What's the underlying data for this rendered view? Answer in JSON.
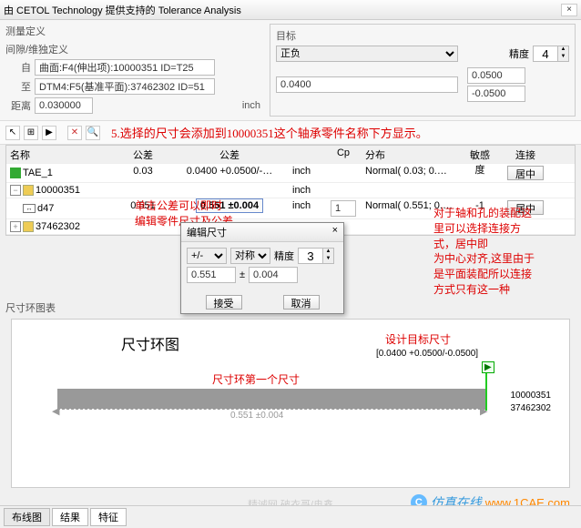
{
  "window": {
    "title": "由 CETOL Technology 提供支持的 Tolerance Analysis",
    "close": "×"
  },
  "definition": {
    "header": "测量定义",
    "sub_header": "间隙/维独定义",
    "from_label": "自",
    "from_value": "曲面:F4(伸出项):10000351 ID=T25",
    "to_label": "至",
    "to_value": "DTM4:F5(基准平面):37462302 ID=51",
    "dist_label": "距离",
    "dist_value": "0.030000",
    "unit": "inch"
  },
  "target": {
    "header": "目标",
    "type": "正负",
    "precision_label": "精度",
    "precision_value": "4",
    "nominal": "0.0400",
    "upper": "0.0500",
    "lower": "-0.0500"
  },
  "annotation_main": "5.选择的尺寸会添加到10000351这个轴承零件名称下方显示。",
  "grid": {
    "headers": {
      "name": "名称",
      "tol_label": "公差",
      "tol_val": "公差",
      "unit": "",
      "cp": "Cp",
      "dist": "分布",
      "sens": "敏感度",
      "conn": "连接"
    },
    "rows": [
      {
        "name": "TAE_1",
        "val": "0.03",
        "tol": "0.0400 +0.0500/-…",
        "unit": "inch",
        "cp": "",
        "dist": "Normal( 0.03; 0.…",
        "sens": "",
        "conn": "居中"
      },
      {
        "name": "10000351",
        "val": "",
        "tol": "",
        "unit": "inch",
        "cp": "",
        "dist": "",
        "sens": "",
        "conn": ""
      },
      {
        "name": "d47",
        "val": "0.551",
        "tol": "0.551 ±0.004",
        "unit": "inch",
        "cp": "1",
        "dist": "Normal( 0.551; 0.…",
        "sens": "-1",
        "conn": "居中"
      },
      {
        "name": "37462302",
        "val": "",
        "tol": "",
        "unit": "",
        "cp": "",
        "dist": "",
        "sens": "",
        "conn": ""
      }
    ]
  },
  "callouts": {
    "tol_edit": "单击公差可以即时\n编辑零件尺寸及公差",
    "conn_help": "对于轴和孔的装配这\n里可以选择连接方\n式，居中即\n为中心对齐,这里由于\n是平面装配所以连接\n方式只有这一种"
  },
  "edit_dialog": {
    "title": "编辑尺寸",
    "close": "×",
    "type": "+/-",
    "symm": "对称",
    "prec_label": "精度",
    "prec_value": "3",
    "nominal": "0.551",
    "plusminus": "±",
    "tolerance": "0.004",
    "accept": "接受",
    "cancel": "取消"
  },
  "chart_section": {
    "header": "尺寸环图表"
  },
  "chart_data": {
    "type": "bar",
    "title": "尺寸环图",
    "annotations": {
      "first_dim": "尺寸环第一个尺寸",
      "target_dim": "设计目标尺寸",
      "target_range": "[0.0400 +0.0500/-0.0500]"
    },
    "bar_label": "0.551 ±0.004",
    "parts": [
      "10000351",
      "37462302"
    ]
  },
  "footer": {
    "tabs": [
      "布线图",
      "结果",
      "特征"
    ],
    "active": 0
  },
  "watermark": {
    "gray": "精诚网 破衣哥/冉鑫",
    "brand1": "仿真在线",
    "brand2": "www.1CAE.com"
  }
}
